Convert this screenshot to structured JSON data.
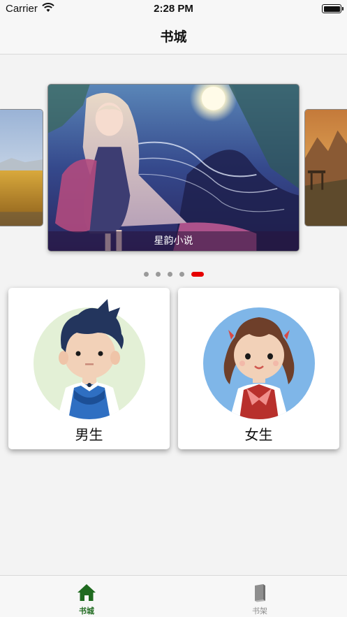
{
  "status_bar": {
    "carrier": "Carrier",
    "time": "2:28 PM",
    "wifi_icon": "wifi-icon",
    "battery_icon": "battery-icon"
  },
  "nav_bar": {
    "title": "书城"
  },
  "carousel": {
    "main_caption": "星韵小说",
    "page_count": 5,
    "active_page_index": 4,
    "active_dot_color": "#e60000",
    "inactive_dot_color": "#9a9a9a"
  },
  "categories": {
    "boy_label": "男生",
    "girl_label": "女生",
    "boy_avatar_bg": "#e3f0d6",
    "girl_avatar_bg": "#7fb6e8"
  },
  "tab_bar": {
    "store": {
      "label": "书城",
      "icon": "home-icon",
      "color": "#1f6a1f"
    },
    "shelf": {
      "label": "书架",
      "icon": "book-icon",
      "color": "#8e8e8e"
    }
  }
}
